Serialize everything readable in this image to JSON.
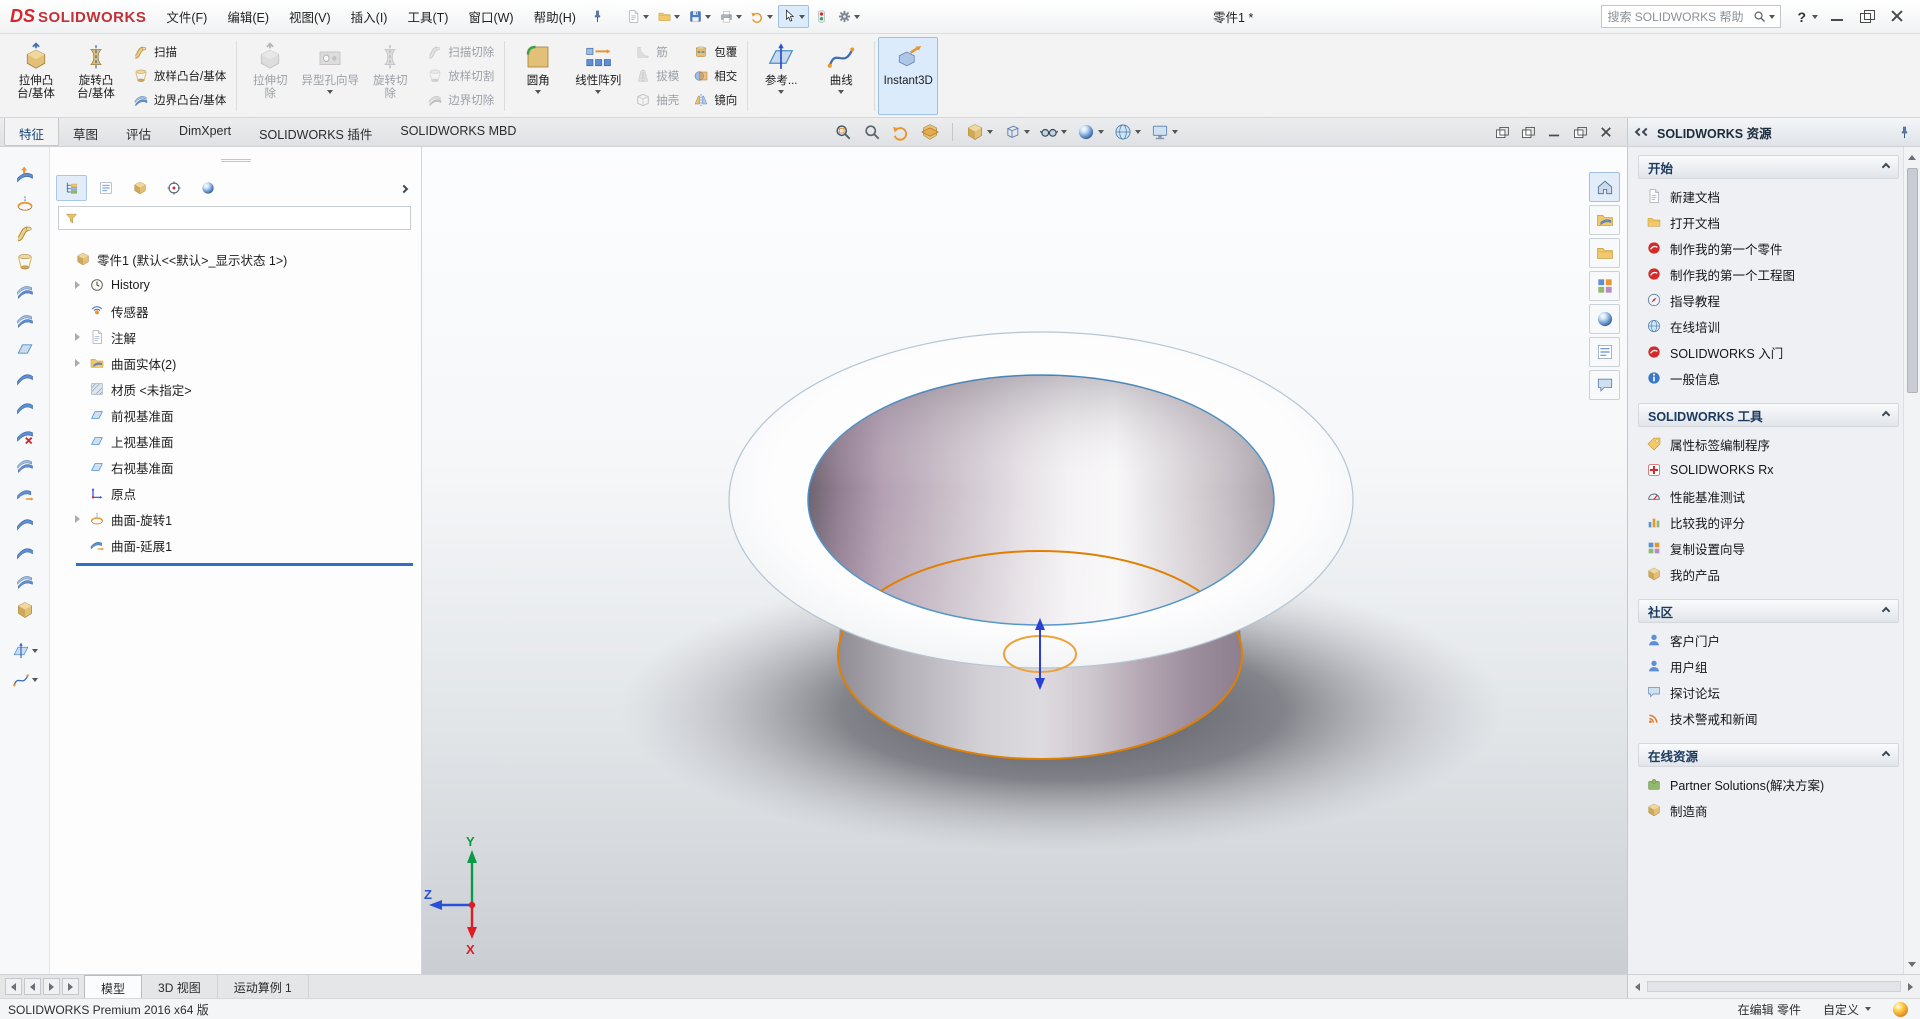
{
  "titlebar": {
    "brand_ds": "DS",
    "brand": "SOLIDWORKS",
    "menus": [
      "文件(F)",
      "编辑(E)",
      "视图(V)",
      "插入(I)",
      "工具(T)",
      "窗口(W)",
      "帮助(H)"
    ],
    "document_title": "零件1 *",
    "search_placeholder": "搜索 SOLIDWORKS 帮助",
    "help_label": "?",
    "quick_tool_icons": [
      "new-document",
      "open-document",
      "save",
      "print",
      "undo",
      "select-cursor",
      "rebuild",
      "options-gear"
    ]
  },
  "ribbon": {
    "tabs": [
      {
        "label": "特征",
        "active": true
      },
      {
        "label": "草图",
        "active": false
      },
      {
        "label": "评估",
        "active": false
      },
      {
        "label": "DimXpert",
        "active": false
      },
      {
        "label": "SOLIDWORKS 插件",
        "active": false
      },
      {
        "label": "SOLIDWORKS MBD",
        "active": false
      }
    ],
    "buttons": [
      {
        "label": "拉伸凸\n台/基体",
        "enabled": true
      },
      {
        "label": "旋转凸\n台/基体",
        "enabled": true
      },
      {
        "label": "扫描",
        "enabled": true
      },
      {
        "label": "放样凸台/基体",
        "enabled": true
      },
      {
        "label": "边界凸台/基体",
        "enabled": true
      },
      {
        "label": "拉伸切\n除",
        "enabled": false
      },
      {
        "label": "异型孔向导",
        "enabled": false
      },
      {
        "label": "旋转切\n除",
        "enabled": false
      },
      {
        "label": "扫描切除",
        "enabled": false
      },
      {
        "label": "放样切割",
        "enabled": false
      },
      {
        "label": "边界切除",
        "enabled": false
      },
      {
        "label": "圆角",
        "enabled": true
      },
      {
        "label": "线性阵列",
        "enabled": true
      },
      {
        "label": "筋",
        "enabled": false
      },
      {
        "label": "拔模",
        "enabled": false
      },
      {
        "label": "抽壳",
        "enabled": false
      },
      {
        "label": "包覆",
        "enabled": true
      },
      {
        "label": "相交",
        "enabled": true
      },
      {
        "label": "镜向",
        "enabled": true
      },
      {
        "label": "参考...",
        "enabled": true
      },
      {
        "label": "曲线",
        "enabled": true
      },
      {
        "label": "Instant3D",
        "enabled": true,
        "pressed": true
      }
    ]
  },
  "left_toolbar_icons": [
    "surface-extrude",
    "surface-revolve",
    "surface-sweep",
    "surface-loft",
    "surface-boundary",
    "surface-offset",
    "surface-planar",
    "surface-ruled",
    "surface-fill",
    "surface-delete-face",
    "surface-replace-face",
    "surface-extend",
    "surface-trim",
    "surface-untrim",
    "surface-knit",
    "surface-thicken",
    "reference-geometry",
    "curves"
  ],
  "feature_tree": {
    "filter_placeholder": "",
    "tab_icons": [
      "feature-manager",
      "property-manager",
      "configuration-manager",
      "dimxpert-manager",
      "display-manager"
    ],
    "items": [
      {
        "label": "零件1 (默认<<默认>_显示状态 1>)",
        "icon": "part",
        "expandable": false
      },
      {
        "label": "History",
        "icon": "history-folder",
        "expandable": true
      },
      {
        "label": "传感器",
        "icon": "sensors",
        "expandable": false
      },
      {
        "label": "注解",
        "icon": "annotations",
        "expandable": true
      },
      {
        "label": "曲面实体(2)",
        "icon": "surface-bodies-folder",
        "expandable": true
      },
      {
        "label": "材质 <未指定>",
        "icon": "material",
        "expandable": false
      },
      {
        "label": "前视基准面",
        "icon": "plane",
        "expandable": false
      },
      {
        "label": "上视基准面",
        "icon": "plane",
        "expandable": false
      },
      {
        "label": "右视基准面",
        "icon": "plane",
        "expandable": false
      },
      {
        "label": "原点",
        "icon": "origin",
        "expandable": false
      },
      {
        "label": "曲面-旋转1",
        "icon": "surface-revolve-feature",
        "expandable": true
      },
      {
        "label": "曲面-延展1",
        "icon": "surface-extend-feature",
        "expandable": false
      }
    ]
  },
  "viewport": {
    "heads_up_icons": [
      "zoom-fit",
      "zoom-to-area",
      "previous-view",
      "section-view",
      "view-orientation",
      "display-style",
      "hide-show-items",
      "edit-appearance",
      "apply-scene",
      "view-settings"
    ],
    "triad": {
      "x": "X",
      "y": "Y",
      "z": "Z"
    },
    "edge_color": "#4a90c8",
    "selected_edge_color": "#e07f00"
  },
  "task_pane": {
    "title": "SOLIDWORKS 资源",
    "tab_icons": [
      "solidworks-resources",
      "design-library",
      "file-explorer",
      "view-palette",
      "appearances-scenes",
      "custom-properties",
      "forum"
    ],
    "sections": [
      {
        "title": "开始",
        "items": [
          "新建文档",
          "打开文档",
          "制作我的第一个零件",
          "制作我的第一个工程图",
          "指导教程",
          "在线培训",
          "SOLIDWORKS 入门",
          "一般信息"
        ]
      },
      {
        "title": "SOLIDWORKS 工具",
        "items": [
          "属性标签编制程序",
          "SOLIDWORKS Rx",
          "性能基准测试",
          "比较我的评分",
          "复制设置向导",
          "我的产品"
        ]
      },
      {
        "title": "社区",
        "items": [
          "客户门户",
          "用户组",
          "探讨论坛",
          "技术警戒和新闻"
        ]
      },
      {
        "title": "在线资源",
        "items": [
          "Partner Solutions(解决方案)",
          "制造商"
        ]
      }
    ]
  },
  "bottom_bar": {
    "tabs": [
      {
        "label": "模型",
        "active": true
      },
      {
        "label": "3D 视图",
        "active": false
      },
      {
        "label": "运动算例 1",
        "active": false
      }
    ]
  },
  "status_bar": {
    "product": "SOLIDWORKS Premium 2016 x64 版",
    "editing": "在编辑 零件",
    "customize": "自定义"
  }
}
